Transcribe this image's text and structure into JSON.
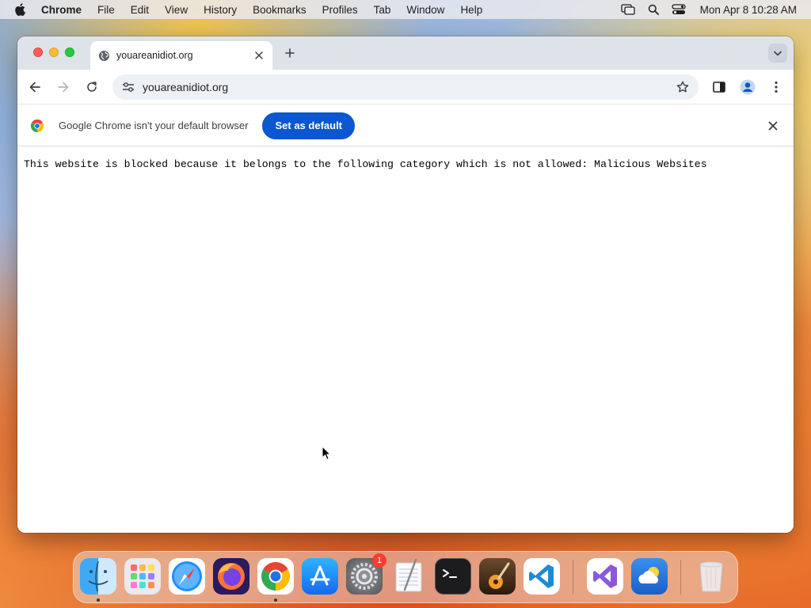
{
  "menubar": {
    "app_name": "Chrome",
    "items": [
      "File",
      "Edit",
      "View",
      "History",
      "Bookmarks",
      "Profiles",
      "Tab",
      "Window",
      "Help"
    ],
    "clock": "Mon Apr 8  10:28 AM",
    "status_icons": [
      "screen-mirroring-icon",
      "spotlight-search-icon",
      "control-center-icon"
    ]
  },
  "browser": {
    "tab": {
      "title": "youareanidiot.org",
      "favicon": "globe-icon"
    },
    "omnibox": {
      "url": "youareanidiot.org"
    },
    "infobar": {
      "message": "Google Chrome isn't your default browser",
      "button_label": "Set as default"
    },
    "page": {
      "message": "This website is blocked because it belongs to the following category which is not allowed: Malicious Websites"
    }
  },
  "dock": {
    "apps": [
      "Finder",
      "Launchpad",
      "Safari",
      "Firefox",
      "Google Chrome",
      "App Store",
      "System Settings",
      "TextEdit",
      "Terminal",
      "GarageBand",
      "Visual Studio Code",
      "Visual Studio",
      "Weather",
      "Trash"
    ],
    "settings_badge": "1"
  },
  "colors": {
    "accent_blue": "#0b57d0",
    "close_red": "#ff5f57",
    "minimize_yellow": "#febc2e",
    "zoom_green": "#28c840"
  }
}
